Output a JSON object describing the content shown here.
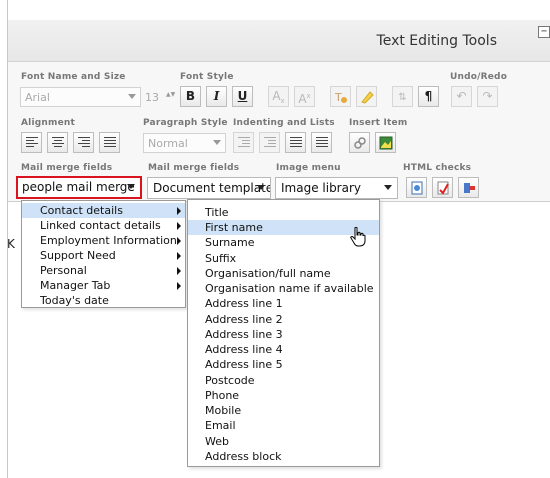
{
  "panel": {
    "title": "Text Editing Tools",
    "collapse_glyph": "−"
  },
  "labels": {
    "font_name_size": "Font Name and Size",
    "font_style": "Font Style",
    "undo_redo": "Undo/Redo",
    "alignment": "Alignment",
    "paragraph_style": "Paragraph Style",
    "indenting_lists": "Indenting and Lists",
    "insert_item": "Insert Item",
    "mail_merge_1": "Mail merge fields",
    "mail_merge_2": "Mail merge fields",
    "image_menu": "Image menu",
    "html_checks": "HTML checks"
  },
  "font": {
    "name_value": "Arial",
    "size_value": "13",
    "size_spinner_glyph": "▲▼"
  },
  "paragraph_style": {
    "value": "Normal"
  },
  "font_style_buttons": {
    "bold": "B",
    "italic": "I",
    "underline": "U"
  },
  "script_buttons": {
    "subscript_base": "A",
    "subscript_mark": "x",
    "superscript_base": "A",
    "superscript_mark": "x"
  },
  "misc_glyphs": {
    "pilcrow": "¶",
    "undo": "↶",
    "redo": "↷",
    "sort": "⇅"
  },
  "dropdowns": {
    "people_mail_merge": "people mail merge",
    "document_templates": "Document templates",
    "image_library": "Image library"
  },
  "content": {
    "visible_char": "K"
  },
  "menu_main": {
    "items": [
      {
        "label": "Contact details",
        "has_submenu": true,
        "highlighted": true
      },
      {
        "label": "Linked contact details",
        "has_submenu": true
      },
      {
        "label": "Employment Information",
        "has_submenu": true
      },
      {
        "label": "Support Need",
        "has_submenu": true
      },
      {
        "label": "Personal",
        "has_submenu": true
      },
      {
        "label": "Manager Tab",
        "has_submenu": true
      },
      {
        "label": "Today's date",
        "has_submenu": false
      }
    ]
  },
  "menu_contact": {
    "items": [
      {
        "label": "Title"
      },
      {
        "label": "First name",
        "highlighted": true
      },
      {
        "label": "Surname"
      },
      {
        "label": "Suffix"
      },
      {
        "label": "Organisation/full name"
      },
      {
        "label": "Organisation name if available"
      },
      {
        "label": "Address line 1"
      },
      {
        "label": "Address line 2"
      },
      {
        "label": "Address line 3"
      },
      {
        "label": "Address line 4"
      },
      {
        "label": "Address line 5"
      },
      {
        "label": "Postcode"
      },
      {
        "label": "Phone"
      },
      {
        "label": "Mobile"
      },
      {
        "label": "Email"
      },
      {
        "label": "Web"
      },
      {
        "label": "Address block"
      }
    ]
  },
  "colors": {
    "highlight": "#cfe2f7",
    "active_border": "#d9141e"
  }
}
